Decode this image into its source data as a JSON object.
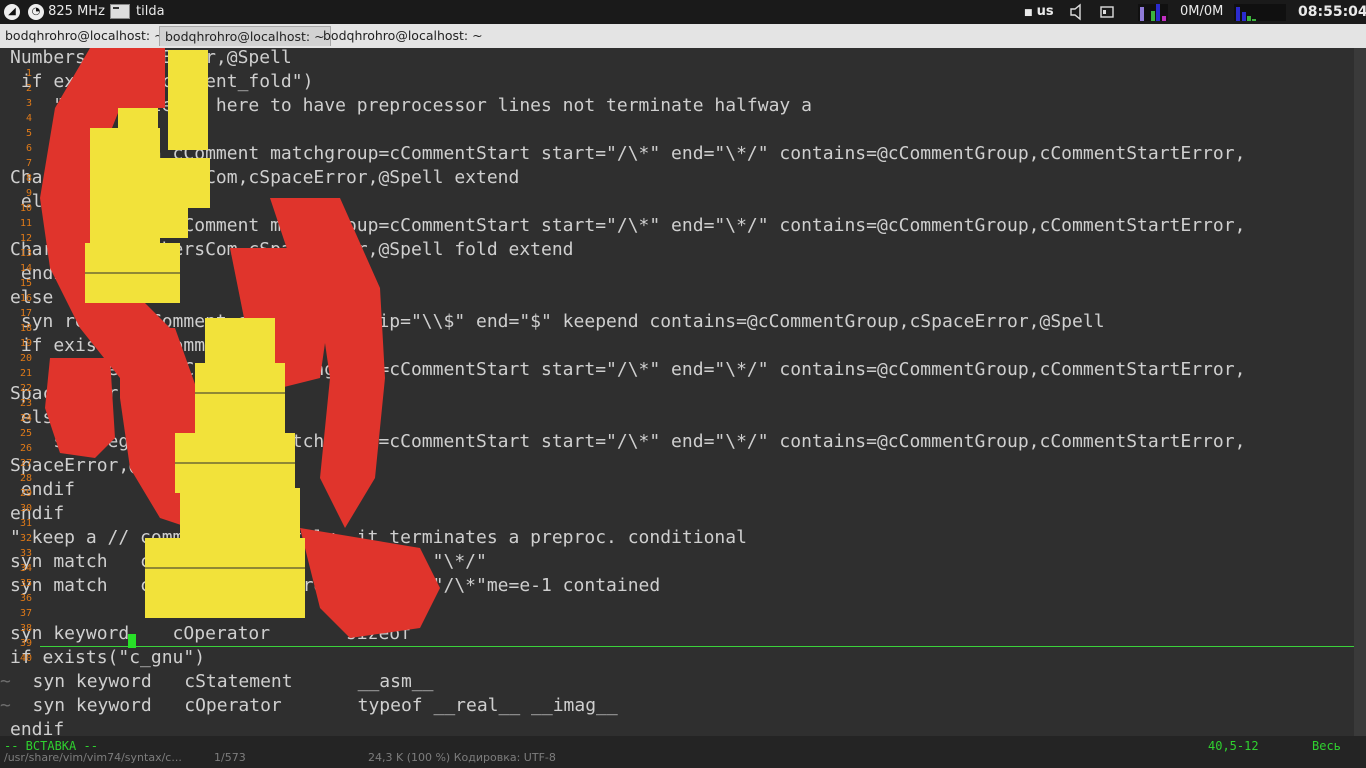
{
  "panel": {
    "cpu": "825 MHz",
    "app": "tilda",
    "kbd_layout": "us",
    "net": "0M/0M",
    "clock": "08:55:04"
  },
  "tabs": [
    {
      "label": "bodqhrohro@localhost: ~",
      "active": false
    },
    {
      "label": "bodqhrohro@localhost: ~",
      "active": true
    },
    {
      "label": "bodqhrohro@localhost: ~",
      "active": false
    }
  ],
  "editor": {
    "lines": [
      {
        "text": "Numbers,cSpaceError,@Spell",
        "tilde": false
      },
      {
        "text": " if exists(\"c_comment_fold\")",
        "tilde": false
      },
      {
        "text": "    \" Use \"extend\" here to have preprocessor lines not terminate halfway a",
        "tilde": false
      },
      {
        "text": "",
        "tilde": false
      },
      {
        "text": "    syn region cComment matchgroup=cCommentStart start=\"/\\*\" end=\"\\*/\" contains=@cCommentGroup,cCommentStartError,",
        "tilde": false
      },
      {
        "text": "Character,cNumbersCom,cSpaceError,@Spell extend",
        "tilde": false
      },
      {
        "text": " else",
        "tilde": false
      },
      {
        "text": "    syn region cComment matchgroup=cCommentStart start=\"/\\*\" end=\"\\*/\" contains=@cCommentGroup,cCommentStartError,",
        "tilde": false
      },
      {
        "text": "Character,cNumbersCom,cSpaceError,@Spell fold extend",
        "tilde": false
      },
      {
        "text": " endif",
        "tilde": false
      },
      {
        "text": "else",
        "tilde": false
      },
      {
        "text": " syn region cComment start=\"//\" skip=\"\\\\$\" end=\"$\" keepend contains=@cCommentGroup,cSpaceError,@Spell",
        "tilde": false
      },
      {
        "text": " if exists(\"c_comment_fold\")",
        "tilde": false
      },
      {
        "text": "    syn region cComment matchgroup=cCommentStart start=\"/\\*\" end=\"\\*/\" contains=@cCommentGroup,cCommentStartError,",
        "tilde": false
      },
      {
        "text": "SpaceError,@Spell fold",
        "tilde": false
      },
      {
        "text": " else",
        "tilde": false
      },
      {
        "text": "    syn region cComment matchgroup=cCommentStart start=\"/\\*\" end=\"\\*/\" contains=@cCommentGroup,cCommentStartError,",
        "tilde": false
      },
      {
        "text": "SpaceError,@Spell extend",
        "tilde": false
      },
      {
        "text": " endif",
        "tilde": false
      },
      {
        "text": "endif",
        "tilde": false
      },
      {
        "text": "\" keep a // comment separately, it terminates a preproc. conditional",
        "tilde": false
      },
      {
        "text": "syn match   cCommentError      display \"\\*/\"",
        "tilde": false
      },
      {
        "text": "syn match   cCommentStartError display \"/\\*\"me=e-1 contained",
        "tilde": false
      },
      {
        "text": "",
        "tilde": false
      },
      {
        "text": "syn keyword    cOperator       sizeof",
        "tilde": false
      },
      {
        "text": "if exists(\"c_gnu\")",
        "tilde": false
      },
      {
        "text": "  syn keyword   cStatement      __asm__",
        "tilde": true
      },
      {
        "text": "  syn keyword   cOperator       typeof __real__ __imag__",
        "tilde": true
      },
      {
        "text": "endif",
        "tilde": false
      }
    ],
    "overlay_line_numbers": [
      "1",
      "2",
      "3",
      "4",
      "5",
      "6",
      "7",
      "8",
      "9",
      "10",
      "11",
      "12",
      "13",
      "14",
      "15",
      "16",
      "17",
      "18",
      "19",
      "20",
      "21",
      "22",
      "23",
      "24",
      "25",
      "26",
      "27",
      "28",
      "29",
      "30",
      "31",
      "32",
      "33",
      "34",
      "35",
      "36",
      "37",
      "38",
      "39",
      "40"
    ]
  },
  "status": {
    "mode": "-- ВСТАВКА --",
    "position": "40,5-12",
    "scroll": "Весь",
    "file_path": "/usr/share/vim/vim74/syntax/c...",
    "file_lines": "1/573",
    "file_info": "24,3 K (100 %) Кодировка: UTF-8"
  },
  "colors": {
    "terminal_bg": "#2f2f2f",
    "text": "#cfcfcf",
    "paren_red": "#e0342c",
    "todo_yellow": "#f2e23a",
    "statusline_green": "#2fd12f",
    "line_number_orange": "#e07a18"
  }
}
